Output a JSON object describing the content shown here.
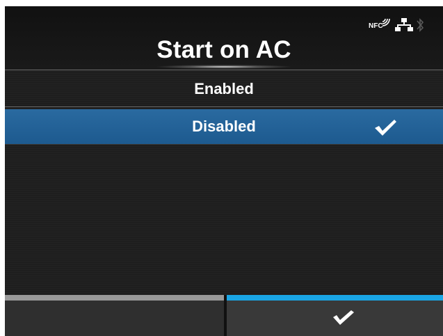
{
  "header": {
    "title": "Start on AC",
    "status_icons": {
      "nfc_label": "NFC",
      "nfc_icon": "nfc-icon",
      "lan_icon": "lan-icon",
      "bluetooth_icon": "bluetooth-icon"
    }
  },
  "options": [
    {
      "label": "Enabled",
      "selected": false
    },
    {
      "label": "Disabled",
      "selected": true,
      "checked": true
    }
  ],
  "footer": {
    "left_button": {
      "icon": "",
      "accent": "#9a9a9a"
    },
    "right_button": {
      "icon": "check-icon",
      "accent": "#1aa6e6"
    }
  },
  "colors": {
    "background": "#1e1e1e",
    "selected_row": "#1f5f95",
    "accent_blue": "#1aa6e6"
  }
}
